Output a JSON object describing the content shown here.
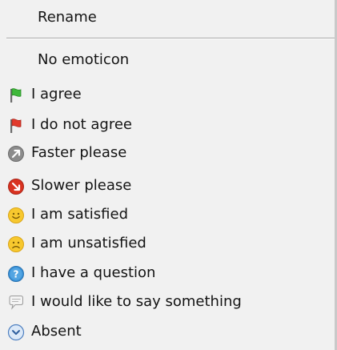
{
  "context_menu": {
    "rename_label": "Rename",
    "emoticon_items": [
      {
        "label": "No emoticon",
        "icon": "none"
      },
      {
        "label": "I agree",
        "icon": "green-flag-icon"
      },
      {
        "label": "I do not agree",
        "icon": "red-flag-icon"
      },
      {
        "label": "Faster please",
        "icon": "faster-arrow-icon"
      },
      {
        "label": "Slower please",
        "icon": "slower-arrow-icon"
      },
      {
        "label": "I am satisfied",
        "icon": "smiley-icon"
      },
      {
        "label": "I am unsatisfied",
        "icon": "sad-face-icon"
      },
      {
        "label": "I have a question",
        "icon": "question-icon"
      },
      {
        "label": "I would like to say something",
        "icon": "speech-bubble-icon"
      },
      {
        "label": "Absent",
        "icon": "absent-clock-icon"
      }
    ],
    "colors": {
      "background": "#f1f1f1",
      "separator": "#a9a9a9",
      "flag_green": "#3fb83a",
      "flag_red": "#e23a2c",
      "slower_red": "#d9321f",
      "smiley_yellow": "#f7c82e",
      "question_blue": "#3b93d8"
    }
  }
}
